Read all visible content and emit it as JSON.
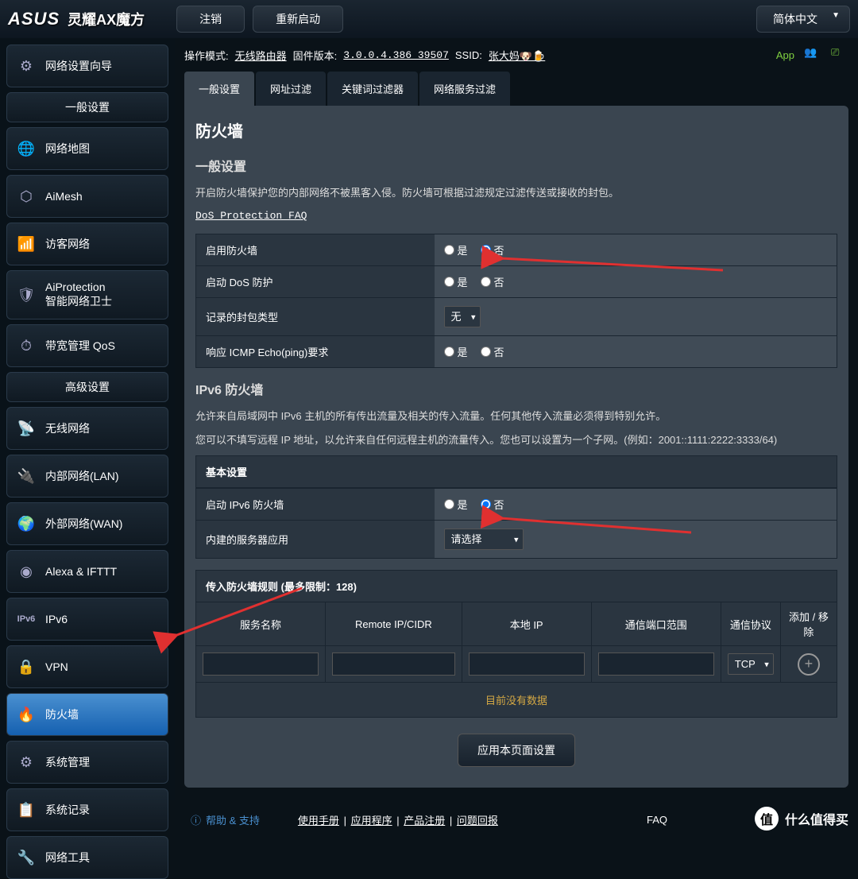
{
  "brand": "ASUS",
  "product": "灵耀AX魔方",
  "topButtons": {
    "logout": "注销",
    "reboot": "重新启动"
  },
  "language": "简体中文",
  "infoBar": {
    "modeLabel": "操作模式:",
    "modeValue": "无线路由器",
    "fwLabel": "固件版本:",
    "fwValue": "3.0.0.4.386_39507",
    "ssidLabel": "SSID:",
    "ssidValue": "张大妈🐶🍺",
    "app": "App"
  },
  "sidebar": {
    "wizard": "网络设置向导",
    "generalHeader": "一般设置",
    "general": [
      {
        "label": "网络地图",
        "icon": "globe"
      },
      {
        "label": "AiMesh",
        "icon": "mesh"
      },
      {
        "label": "访客网络",
        "icon": "guest"
      },
      {
        "label": "AiProtection\n智能网络卫士",
        "icon": "shield"
      },
      {
        "label": "带宽管理 QoS",
        "icon": "gauge"
      }
    ],
    "advancedHeader": "高级设置",
    "advanced": [
      {
        "label": "无线网络",
        "icon": "wifi"
      },
      {
        "label": "内部网络(LAN)",
        "icon": "lan"
      },
      {
        "label": "外部网络(WAN)",
        "icon": "wan"
      },
      {
        "label": "Alexa & IFTTT",
        "icon": "alexa"
      },
      {
        "label": "IPv6",
        "icon": "ipv6"
      },
      {
        "label": "VPN",
        "icon": "vpn"
      },
      {
        "label": "防火墙",
        "icon": "fire",
        "active": true
      },
      {
        "label": "系统管理",
        "icon": "gear"
      },
      {
        "label": "系统记录",
        "icon": "log"
      },
      {
        "label": "网络工具",
        "icon": "tool"
      }
    ]
  },
  "tabs": [
    "一般设置",
    "网址过滤",
    "关键词过滤器",
    "网络服务过滤"
  ],
  "activeTab": 0,
  "page": {
    "title": "防火墙",
    "sectionGeneral": "一般设置",
    "descGeneral": "开启防火墙保护您的内部网络不被黑客入侵。防火墙可根据过滤规定过滤传送或接收的封包。",
    "faq": "DoS Protection FAQ",
    "rows": {
      "enableFw": "启用防火墙",
      "enableDos": "启动 DoS 防护",
      "packetType": "记录的封包类型",
      "icmp": "响应 ICMP Echo(ping)要求"
    },
    "yes": "是",
    "no": "否",
    "packetNone": "无",
    "ipv6Title": "IPv6 防火墙",
    "ipv6Desc1": "允许来自局域网中 IPv6 主机的所有传出流量及相关的传入流量。任何其他传入流量必须得到特别允许。",
    "ipv6Desc2": "您可以不填写远程 IP 地址，以允许来自任何远程主机的流量传入。您也可以设置为一个子网。(例如：2001::1111:2222:3333/64)",
    "basic": "基本设置",
    "enableIpv6Fw": "启动 IPv6 防火墙",
    "serverApp": "内建的服务器应用",
    "selectPlaceholder": "请选择",
    "ruleTitle": "传入防火墙规则 (最多限制：128)",
    "ruleHeaders": [
      "服务名称",
      "Remote IP/CIDR",
      "本地 IP",
      "通信端口范围",
      "通信协议",
      "添加 / 移除"
    ],
    "protocol": "TCP",
    "noData": "目前没有数据",
    "apply": "应用本页面设置"
  },
  "footer": {
    "help": "帮助 & 支持",
    "links": [
      "使用手册",
      "应用程序",
      "产品注册",
      "问题回报"
    ],
    "faq": "FAQ"
  },
  "watermark": "什么值得买",
  "watermarkBadge": "值"
}
